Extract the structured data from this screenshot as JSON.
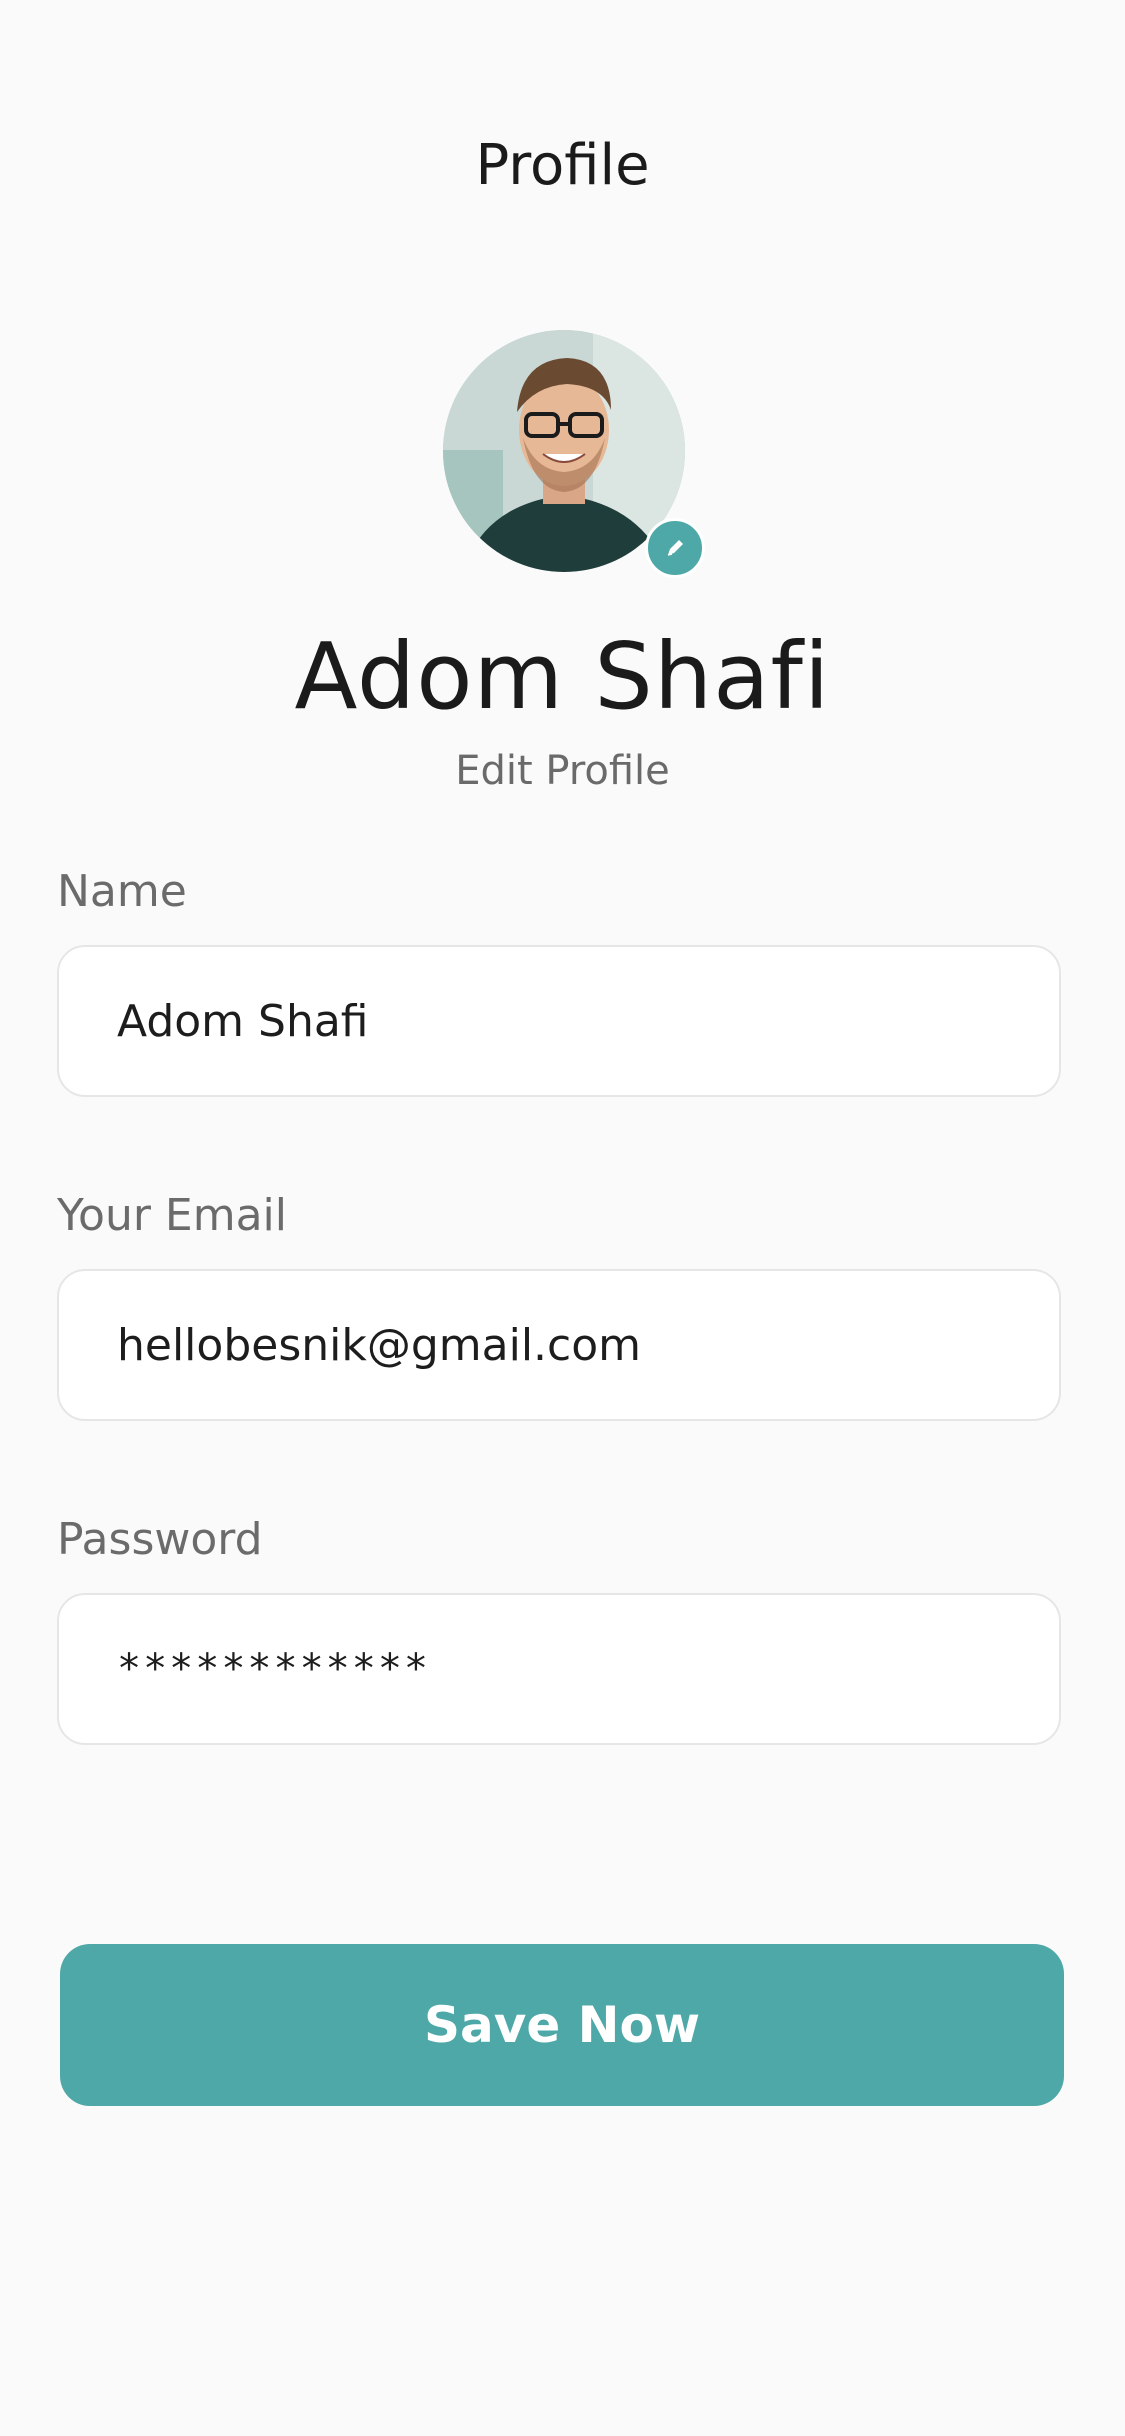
{
  "header": {
    "title": "Profile"
  },
  "profile": {
    "name": "Adom Shafi",
    "edit_link": "Edit Profile",
    "avatar_icon": "person-photo",
    "edit_icon": "pencil-icon"
  },
  "form": {
    "name": {
      "label": "Name",
      "value": "Adom Shafi"
    },
    "email": {
      "label": "Your Email",
      "value": "hellobesnik@gmail.com"
    },
    "password": {
      "label": "Password",
      "value": "************"
    }
  },
  "actions": {
    "save_label": "Save Now"
  },
  "colors": {
    "accent": "#4fa8a8",
    "background": "#fafafa",
    "title_text": "#1b1b1b",
    "muted_text": "#6b6b6b",
    "field_border": "#e6e6e6"
  }
}
